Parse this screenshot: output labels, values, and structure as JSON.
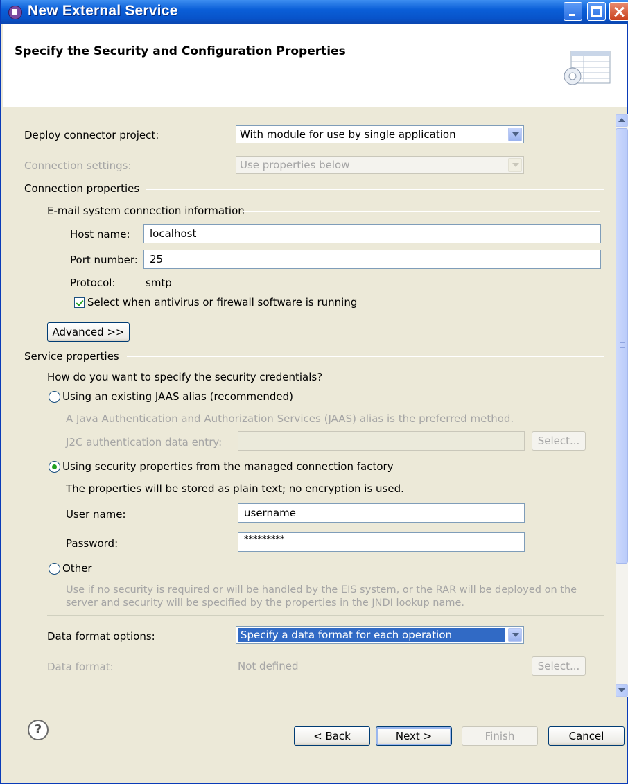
{
  "window": {
    "title": "New External Service"
  },
  "header": {
    "title": "Specify the Security and Configuration Properties"
  },
  "deploy": {
    "label": "Deploy connector project:",
    "value": "With module for use by single application"
  },
  "connection_settings": {
    "label": "Connection settings:",
    "value": "Use properties below"
  },
  "connection_properties": {
    "group_label": "Connection properties",
    "email_group_label": "E-mail system connection information",
    "host_label": "Host name:",
    "host_value": "localhost",
    "port_label": "Port number:",
    "port_value": "25",
    "protocol_label": "Protocol:",
    "protocol_value": "smtp",
    "antivirus_label": "Select when antivirus or firewall software is running",
    "advanced_label": "Advanced >>"
  },
  "service_properties": {
    "group_label": "Service properties",
    "question": "How do you want to specify the security credentials?",
    "jaas_label": "Using an existing JAAS alias (recommended)",
    "jaas_desc": "A Java Authentication and Authorization Services (JAAS) alias is the preferred method.",
    "j2c_label": "J2C authentication data entry:",
    "j2c_select": "Select...",
    "mcf_label": "Using security properties from the managed connection factory",
    "mcf_desc": "The properties will be stored as plain text; no encryption is used.",
    "user_label": "User name:",
    "user_value": "username",
    "password_label": "Password:",
    "password_value": "*********",
    "other_label": "Other",
    "other_desc_1": "Use if no security is required or will be handled by the EIS system, or the RAR will be deployed on the",
    "other_desc_2": "server and security will be specified by the properties in the JNDI lookup name."
  },
  "data_format": {
    "options_label": "Data format options:",
    "options_value": "Specify a data format for each operation",
    "format_label": "Data format:",
    "format_value": "Not defined",
    "select_label": "Select..."
  },
  "footer": {
    "back": "< Back",
    "next": "Next >",
    "finish": "Finish",
    "cancel": "Cancel"
  }
}
